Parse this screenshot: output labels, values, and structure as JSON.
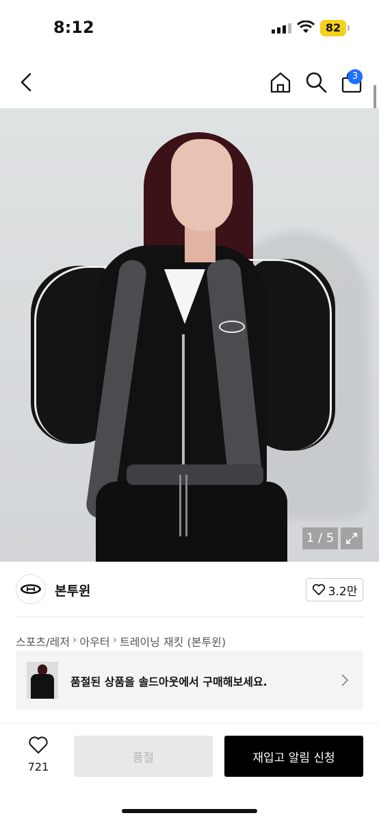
{
  "status_bar": {
    "time": "8:12",
    "battery": "82"
  },
  "nav": {
    "cart_count": "3"
  },
  "gallery": {
    "counter": "1 / 5"
  },
  "brand": {
    "name": "본투윈",
    "likes": "3.2만"
  },
  "breadcrumb": {
    "items": [
      "스포츠/레저",
      "아우터",
      "트레이닝 재킷 (본투윈)"
    ]
  },
  "banner": {
    "text": "품절된 상품을 솔드아웃에서 구매해보세요."
  },
  "bottom_bar": {
    "wishlist_count": "721",
    "soldout_label": "품절",
    "restock_label": "재입고 알림 신청"
  },
  "colors": {
    "accent": "#1f6fff",
    "battery": "#f5d01c",
    "cta": "#000000"
  }
}
